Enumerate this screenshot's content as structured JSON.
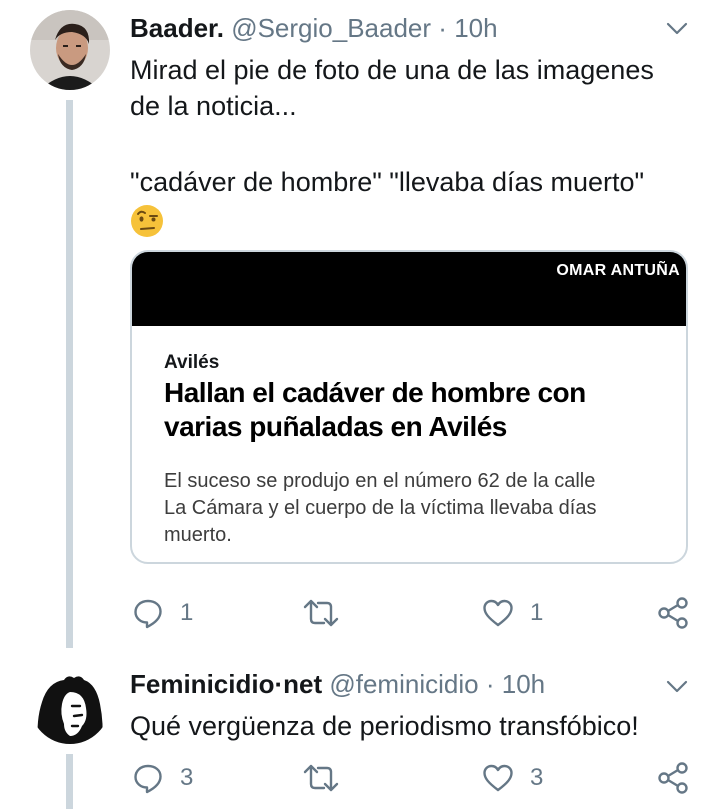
{
  "tweets": [
    {
      "name": "Baader.",
      "handle": "@Sergio_Baader",
      "separator": "·",
      "time": "10h",
      "text_line1": "Mirad el pie de foto de una de las imagenes",
      "text_line2": "de la noticia...",
      "text_line3": "\"cadáver de hombre\" \"llevaba días muerto\"",
      "emoji": "face-with-raised-eyebrow",
      "card": {
        "image_credit": "OMAR ANTUÑA",
        "section": "Avilés",
        "title_line1": "Hallan el cadáver de hombre con",
        "title_line2": "varias puñaladas en Avilés",
        "desc_line1": "El suceso se produjo en el número 62 de la calle",
        "desc_line2": "La Cámara y el cuerpo de la víctima llevaba días",
        "desc_line3": "muerto."
      },
      "replies": "1",
      "retweets": "",
      "likes": "1"
    },
    {
      "name": "Feminicidio·net",
      "handle": "@feminicidio",
      "separator": "·",
      "time": "10h",
      "text_line1": "Qué vergüenza de periodismo transfóbico!",
      "replies": "3",
      "retweets": "",
      "likes": "3"
    }
  ],
  "colors": {
    "text": "#14171a",
    "muted": "#657786",
    "thread_line": "#ccd6dd",
    "card_border": "#ccd6dd"
  },
  "icons": [
    "chat-bubble-icon",
    "retweet-icon",
    "heart-icon",
    "share-icon",
    "chevron-down-icon"
  ]
}
